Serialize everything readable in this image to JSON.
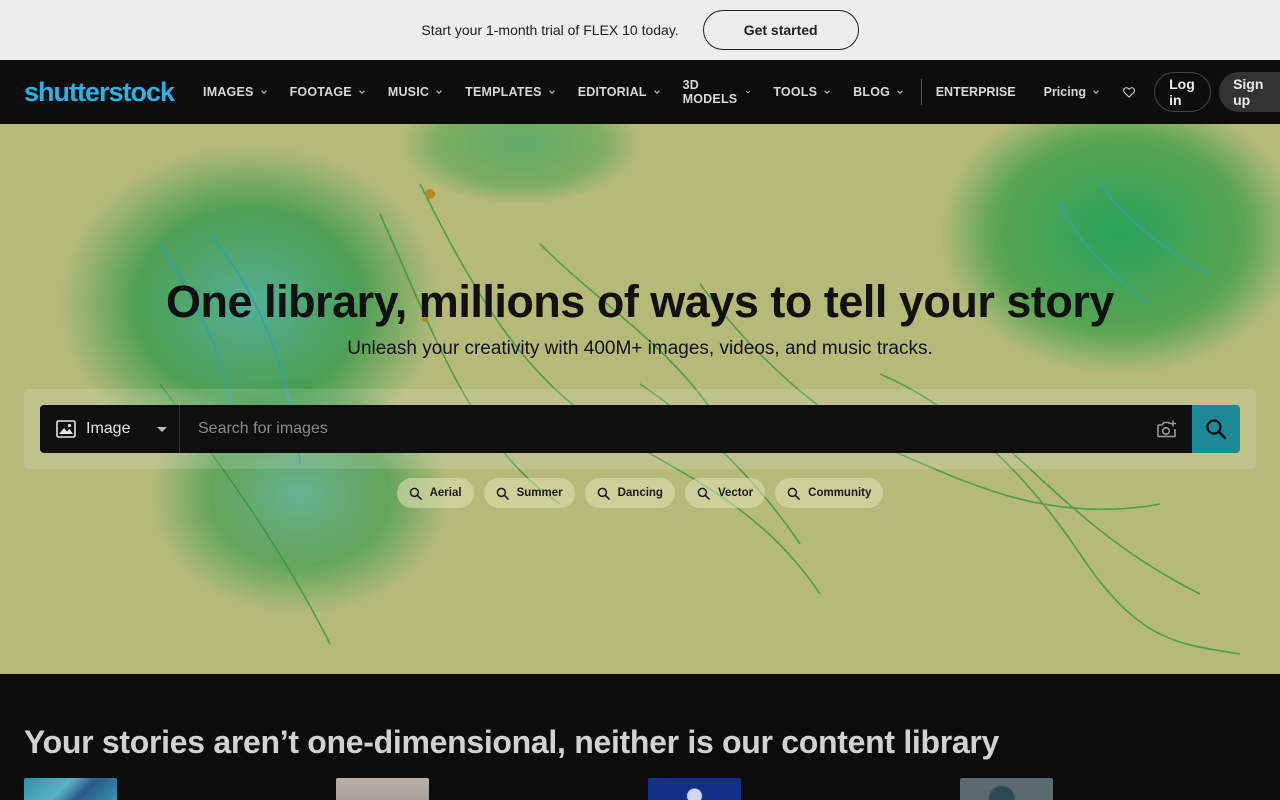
{
  "promo": {
    "text": "Start your 1-month trial of FLEX 10 today.",
    "cta": "Get started"
  },
  "nav": {
    "logo": "shutterstock",
    "items": [
      {
        "label": "IMAGES"
      },
      {
        "label": "FOOTAGE"
      },
      {
        "label": "MUSIC"
      },
      {
        "label": "TEMPLATES"
      },
      {
        "label": "EDITORIAL"
      },
      {
        "label": "3D MODELS"
      },
      {
        "label": "TOOLS"
      },
      {
        "label": "BLOG"
      }
    ],
    "enterprise": "ENTERPRISE",
    "pricing": "Pricing",
    "login": "Log in",
    "signup": "Sign up"
  },
  "hero": {
    "title": "One library, millions of ways to tell your story",
    "subtitle": "Unleash your creativity with 400M+ images, videos, and music tracks.",
    "search": {
      "type": "Image",
      "placeholder": "Search for images"
    },
    "chips": [
      "Aerial",
      "Summer",
      "Dancing",
      "Vector",
      "Community"
    ]
  },
  "section": {
    "title": "Your stories aren’t one-dimensional, neither is our content library"
  },
  "colors": {
    "brand": "#2bb3e6",
    "search_button": "#1b8a96",
    "nav_bg": "#0d0d0d",
    "hero_bg": "#e7ef9c"
  },
  "icons": {
    "image_type": "image-icon",
    "camera": "camera-search-icon",
    "search": "search-icon",
    "heart": "heart-icon",
    "chevron": "chevron-down-icon"
  }
}
